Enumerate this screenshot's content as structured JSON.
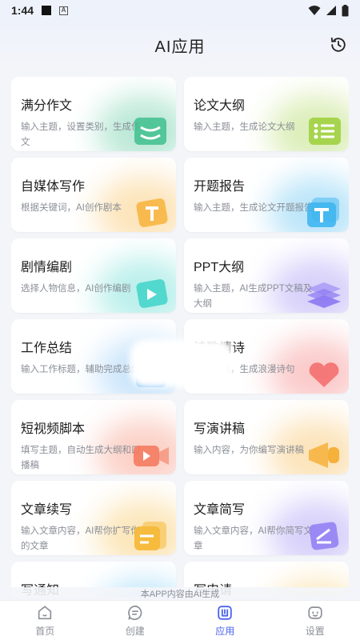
{
  "status": {
    "time": "1:44",
    "a_icon": "A"
  },
  "header": {
    "title": "AI应用"
  },
  "cards": [
    {
      "title": "满分作文",
      "desc": "输入主题，设置类别，生成作文",
      "color": "#3fbf8e"
    },
    {
      "title": "论文大纲",
      "desc": "输入主题，生成论文大纲",
      "color": "#9ccf3a"
    },
    {
      "title": "自媒体写作",
      "desc": "根据关键词，AI创作剧本",
      "color": "#f7b33b"
    },
    {
      "title": "开题报告",
      "desc": "输入主题，生成论文开题报告",
      "color": "#3fb6ef"
    },
    {
      "title": "剧情编剧",
      "desc": "选择人物信息，AI创作编剧",
      "color": "#3fd3c8"
    },
    {
      "title": "PPT大纲",
      "desc": "输入主题，AI生成PPT文稿及大纲",
      "color": "#8f7cf2"
    },
    {
      "title": "工作总结",
      "desc": "输入工作标题，辅助完成总结",
      "color": "#6fb7f3"
    },
    {
      "title": "诗歌情诗",
      "desc": "输入主题，生成浪漫诗句",
      "color": "#f36a6a"
    },
    {
      "title": "短视频脚本",
      "desc": "填写主题，自动生成大纲和口播稿",
      "color": "#f47b5f"
    },
    {
      "title": "写演讲稿",
      "desc": "输入内容，为你编写演讲稿",
      "color": "#f6b13b"
    },
    {
      "title": "文章续写",
      "desc": "输入文章内容，AI帮你扩写你的文章",
      "color": "#f6b93a"
    },
    {
      "title": "文章简写",
      "desc": "输入文章内容，AI帮你简写文章",
      "color": "#8f7cf2"
    },
    {
      "title": "写通知",
      "desc": "",
      "color": "#3fb6ef"
    },
    {
      "title": "写申请",
      "desc": "",
      "color": "#f6b93a"
    }
  ],
  "notice": "本APP内容由AI生成",
  "tabs": [
    {
      "label": "首页",
      "icon": "home-icon",
      "active": false
    },
    {
      "label": "创建",
      "icon": "create-icon",
      "active": false
    },
    {
      "label": "应用",
      "icon": "apps-icon",
      "active": true
    },
    {
      "label": "设置",
      "icon": "settings-icon",
      "active": false
    }
  ],
  "colors": {
    "accent": "#4b63f0",
    "text_secondary": "#8b8f97"
  }
}
